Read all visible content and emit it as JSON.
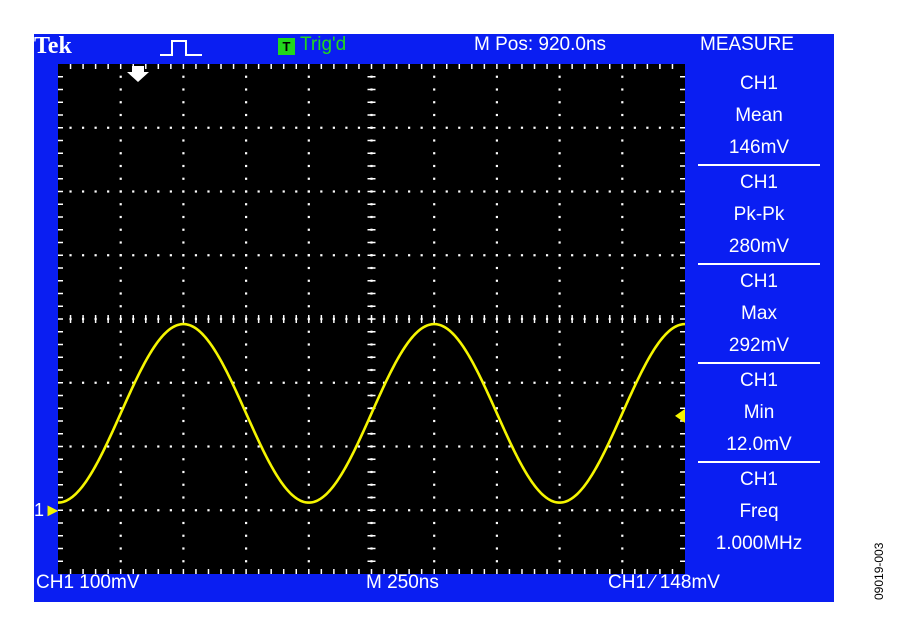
{
  "header": {
    "brand": "Tek",
    "trigger_icon_letter": "T",
    "trigger_status": "Trig'd",
    "horizontal_position": "M Pos: 920.0ns",
    "measure_title": "MEASURE"
  },
  "measurements": [
    {
      "channel": "CH1",
      "type": "Mean",
      "value": "146mV"
    },
    {
      "channel": "CH1",
      "type": "Pk-Pk",
      "value": "280mV"
    },
    {
      "channel": "CH1",
      "type": "Max",
      "value": "292mV"
    },
    {
      "channel": "CH1",
      "type": "Min",
      "value": "12.0mV"
    },
    {
      "channel": "CH1",
      "type": "Freq",
      "value": "1.000MHz"
    }
  ],
  "footer": {
    "ch1_scale": "CH1  100mV",
    "timebase": "M 250ns",
    "trigger_readout": "CH1  ∕  148mV"
  },
  "ch1_marker": "1",
  "figure_id": "09019-003",
  "colors": {
    "frame": "#0a1ef2",
    "screen": "#000000",
    "trace": "#f5f500",
    "grid": "#ffffff",
    "trigger_indicator": "#22d61d"
  },
  "icons": [
    "pulse-icon",
    "trigger-icon",
    "trigger-position-arrow-icon",
    "trigger-level-arrow-icon",
    "ground-reference-arrow-icon"
  ],
  "chart_data": {
    "type": "line",
    "series": [
      {
        "name": "CH1",
        "waveform": "sine",
        "min_mV": 12.0,
        "max_mV": 292,
        "mean_mV": 146,
        "frequency_MHz": 1.0
      }
    ],
    "volts_per_div_mV": 100,
    "time_per_div_ns": 250,
    "divisions": {
      "x": 10,
      "y": 8
    },
    "ground_reference_div_from_bottom": 1,
    "start_phase_deg": 270,
    "trigger_level_mV": 148,
    "grid": true
  }
}
